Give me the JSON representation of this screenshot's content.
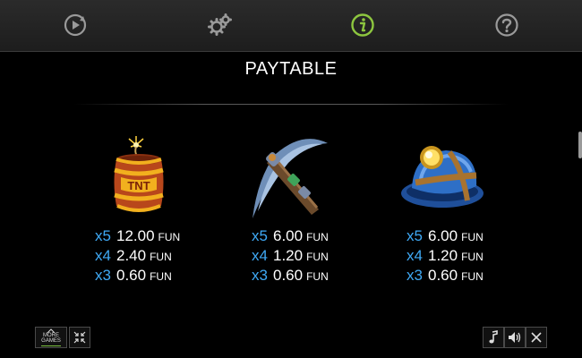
{
  "nav": {
    "items": [
      {
        "icon": "replay-icon",
        "active": false
      },
      {
        "icon": "settings-icon",
        "active": false
      },
      {
        "icon": "info-icon",
        "active": true
      },
      {
        "icon": "help-icon",
        "active": false
      }
    ],
    "active_color": "#8dc63f",
    "inactive_color": "#9a9a9a"
  },
  "title": "PAYTABLE",
  "symbols": [
    {
      "icon": "tnt-barrel-icon",
      "label": "TNT",
      "pays": [
        {
          "mult": "x5",
          "amount": "12.00",
          "currency": "FUN"
        },
        {
          "mult": "x4",
          "amount": "2.40",
          "currency": "FUN"
        },
        {
          "mult": "x3",
          "amount": "0.60",
          "currency": "FUN"
        }
      ]
    },
    {
      "icon": "pickaxe-icon",
      "pays": [
        {
          "mult": "x5",
          "amount": "6.00",
          "currency": "FUN"
        },
        {
          "mult": "x4",
          "amount": "1.20",
          "currency": "FUN"
        },
        {
          "mult": "x3",
          "amount": "0.60",
          "currency": "FUN"
        }
      ]
    },
    {
      "icon": "miner-helmet-icon",
      "pays": [
        {
          "mult": "x5",
          "amount": "6.00",
          "currency": "FUN"
        },
        {
          "mult": "x4",
          "amount": "1.20",
          "currency": "FUN"
        },
        {
          "mult": "x3",
          "amount": "0.60",
          "currency": "FUN"
        }
      ]
    }
  ],
  "bottom_left": {
    "more_games_line1": "MORE",
    "more_games_line2": "GAMES",
    "fullscreen_icon": "collapse-arrows-icon"
  },
  "bottom_right": {
    "music_icon": "music-note-icon",
    "sound_icon": "speaker-icon",
    "close_icon": "close-icon"
  },
  "colors": {
    "multiplier": "#3fa9f5",
    "background": "#000000"
  }
}
